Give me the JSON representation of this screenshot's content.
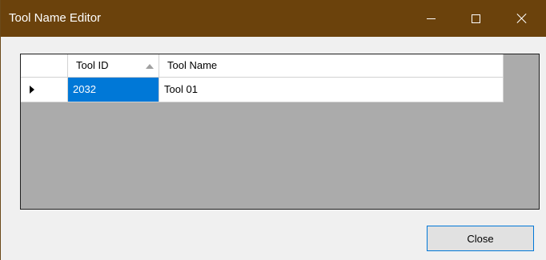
{
  "window": {
    "title": "Tool Name Editor",
    "titlebar_color": "#6b420c",
    "controls": {
      "minimize": "minimize-icon",
      "maximize": "maximize-icon",
      "close": "close-icon"
    }
  },
  "grid": {
    "columns": [
      {
        "label": "Tool ID",
        "sorted": "ascending"
      },
      {
        "label": "Tool Name"
      }
    ],
    "rows": [
      {
        "tool_id": "2032",
        "tool_name": "Tool 01",
        "current": true,
        "selected_cell": "tool_id"
      }
    ],
    "selection_color": "#0078d7"
  },
  "footer": {
    "close_label": "Close"
  }
}
